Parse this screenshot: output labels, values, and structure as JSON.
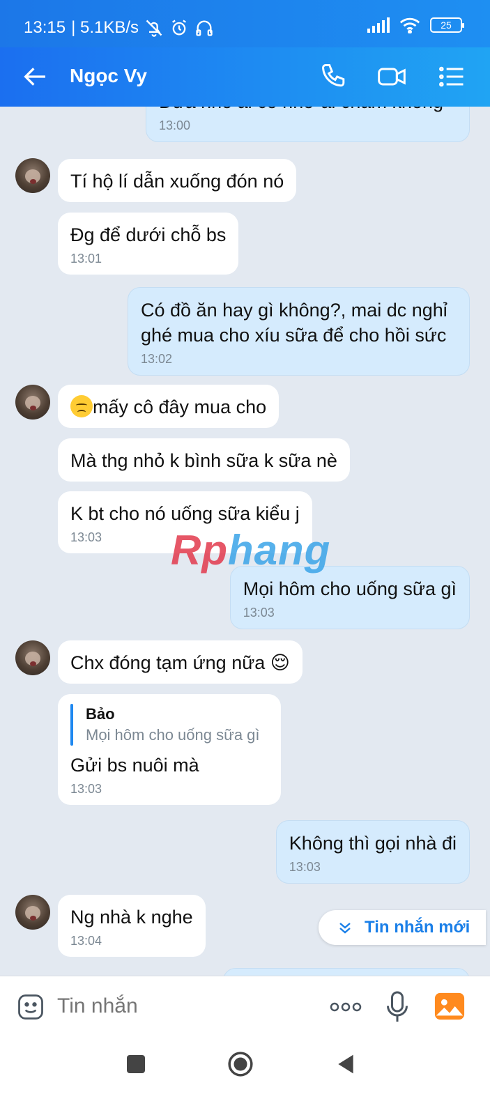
{
  "status_bar": {
    "time": "13:15",
    "speed": "| 5.1KB/s",
    "battery": "25"
  },
  "header": {
    "contact_name": "Ngọc Vy"
  },
  "messages": [
    {
      "text": "Đứa nhỏ ai có nhờ ai chăm không",
      "time": "13:00"
    },
    {
      "text": "Tí hộ lí dẫn xuống đón nó"
    },
    {
      "text": "Đg để dưới chỗ bs",
      "time": "13:01"
    },
    {
      "text": "Có đồ ăn hay gì không?, mai dc nghỉ ghé mua cho xíu sữa để cho hồi sức",
      "time": "13:02"
    },
    {
      "text": "mấy cô đây mua cho"
    },
    {
      "text": "Mà thg nhỏ k bình sữa k sữa nè"
    },
    {
      "text": "K bt cho nó uống sữa kiểu j",
      "time": "13:03"
    },
    {
      "text": "Mọi hôm cho uống sữa gì",
      "time": "13:03"
    },
    {
      "text": "Chx đóng tạm ứng nữa 😌"
    },
    {
      "quote_author": "Bảo",
      "quote_text": "Mọi hôm cho uống sữa gì",
      "text": "Gửi bs nuôi mà",
      "time": "13:03"
    },
    {
      "text": "Không thì gọi nhà đi",
      "time": "13:03"
    },
    {
      "text": "Ng nhà k nghe",
      "time": "13:04"
    }
  ],
  "watermark": {
    "part1": "Rp",
    "part2": "hang"
  },
  "new_messages_label": "Tin nhắn mới",
  "input": {
    "placeholder": "Tin nhắn"
  },
  "icons": [
    "back-arrow-icon",
    "phone-icon",
    "video-call-icon",
    "menu-list-icon",
    "sticker-icon",
    "more-icon",
    "microphone-icon",
    "image-icon",
    "chevron-down-icon"
  ],
  "colors": {
    "header": "#1e8ff2",
    "outgoing_bubble": "#d5ebfd",
    "incoming_bubble": "#ffffff",
    "chat_background": "#e3e9f1",
    "accent": "#1a7fe8"
  }
}
